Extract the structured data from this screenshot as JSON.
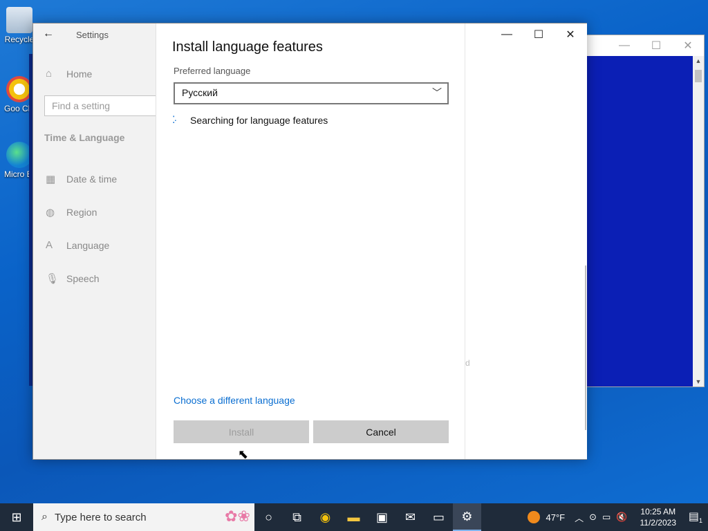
{
  "desktop": {
    "icons": [
      {
        "label": "Recycle",
        "icon": "recycle-bin-icon"
      },
      {
        "label": "Goo Chr",
        "icon": "chrome-icon"
      },
      {
        "label": "Micro Edg",
        "icon": "edge-icon"
      }
    ]
  },
  "settings": {
    "app_title": "Settings",
    "home_label": "Home",
    "search_placeholder": "Find a setting",
    "section_title": "Time & Language",
    "nav": [
      {
        "label": "Date & time",
        "icon": "calendar-icon"
      },
      {
        "label": "Region",
        "icon": "globe-icon"
      },
      {
        "label": "Language",
        "icon": "language-icon"
      },
      {
        "label": "Speech",
        "icon": "microphone-icon"
      }
    ],
    "right_faint_text": "d"
  },
  "dialog": {
    "title": "Install language features",
    "preferred_label": "Preferred language",
    "selected_language": "Русский",
    "status_text": "Searching for language features",
    "link_text": "Choose a different language",
    "install_label": "Install",
    "cancel_label": "Cancel"
  },
  "taskbar": {
    "search_placeholder": "Type here to search",
    "weather_temp": "47°F",
    "time": "10:25 AM",
    "date": "11/2/2023",
    "notification_count": "1"
  },
  "colors": {
    "accent": "#0a6ed1",
    "taskbar": "#1f2b3a",
    "desktop": "#0b57b8"
  }
}
